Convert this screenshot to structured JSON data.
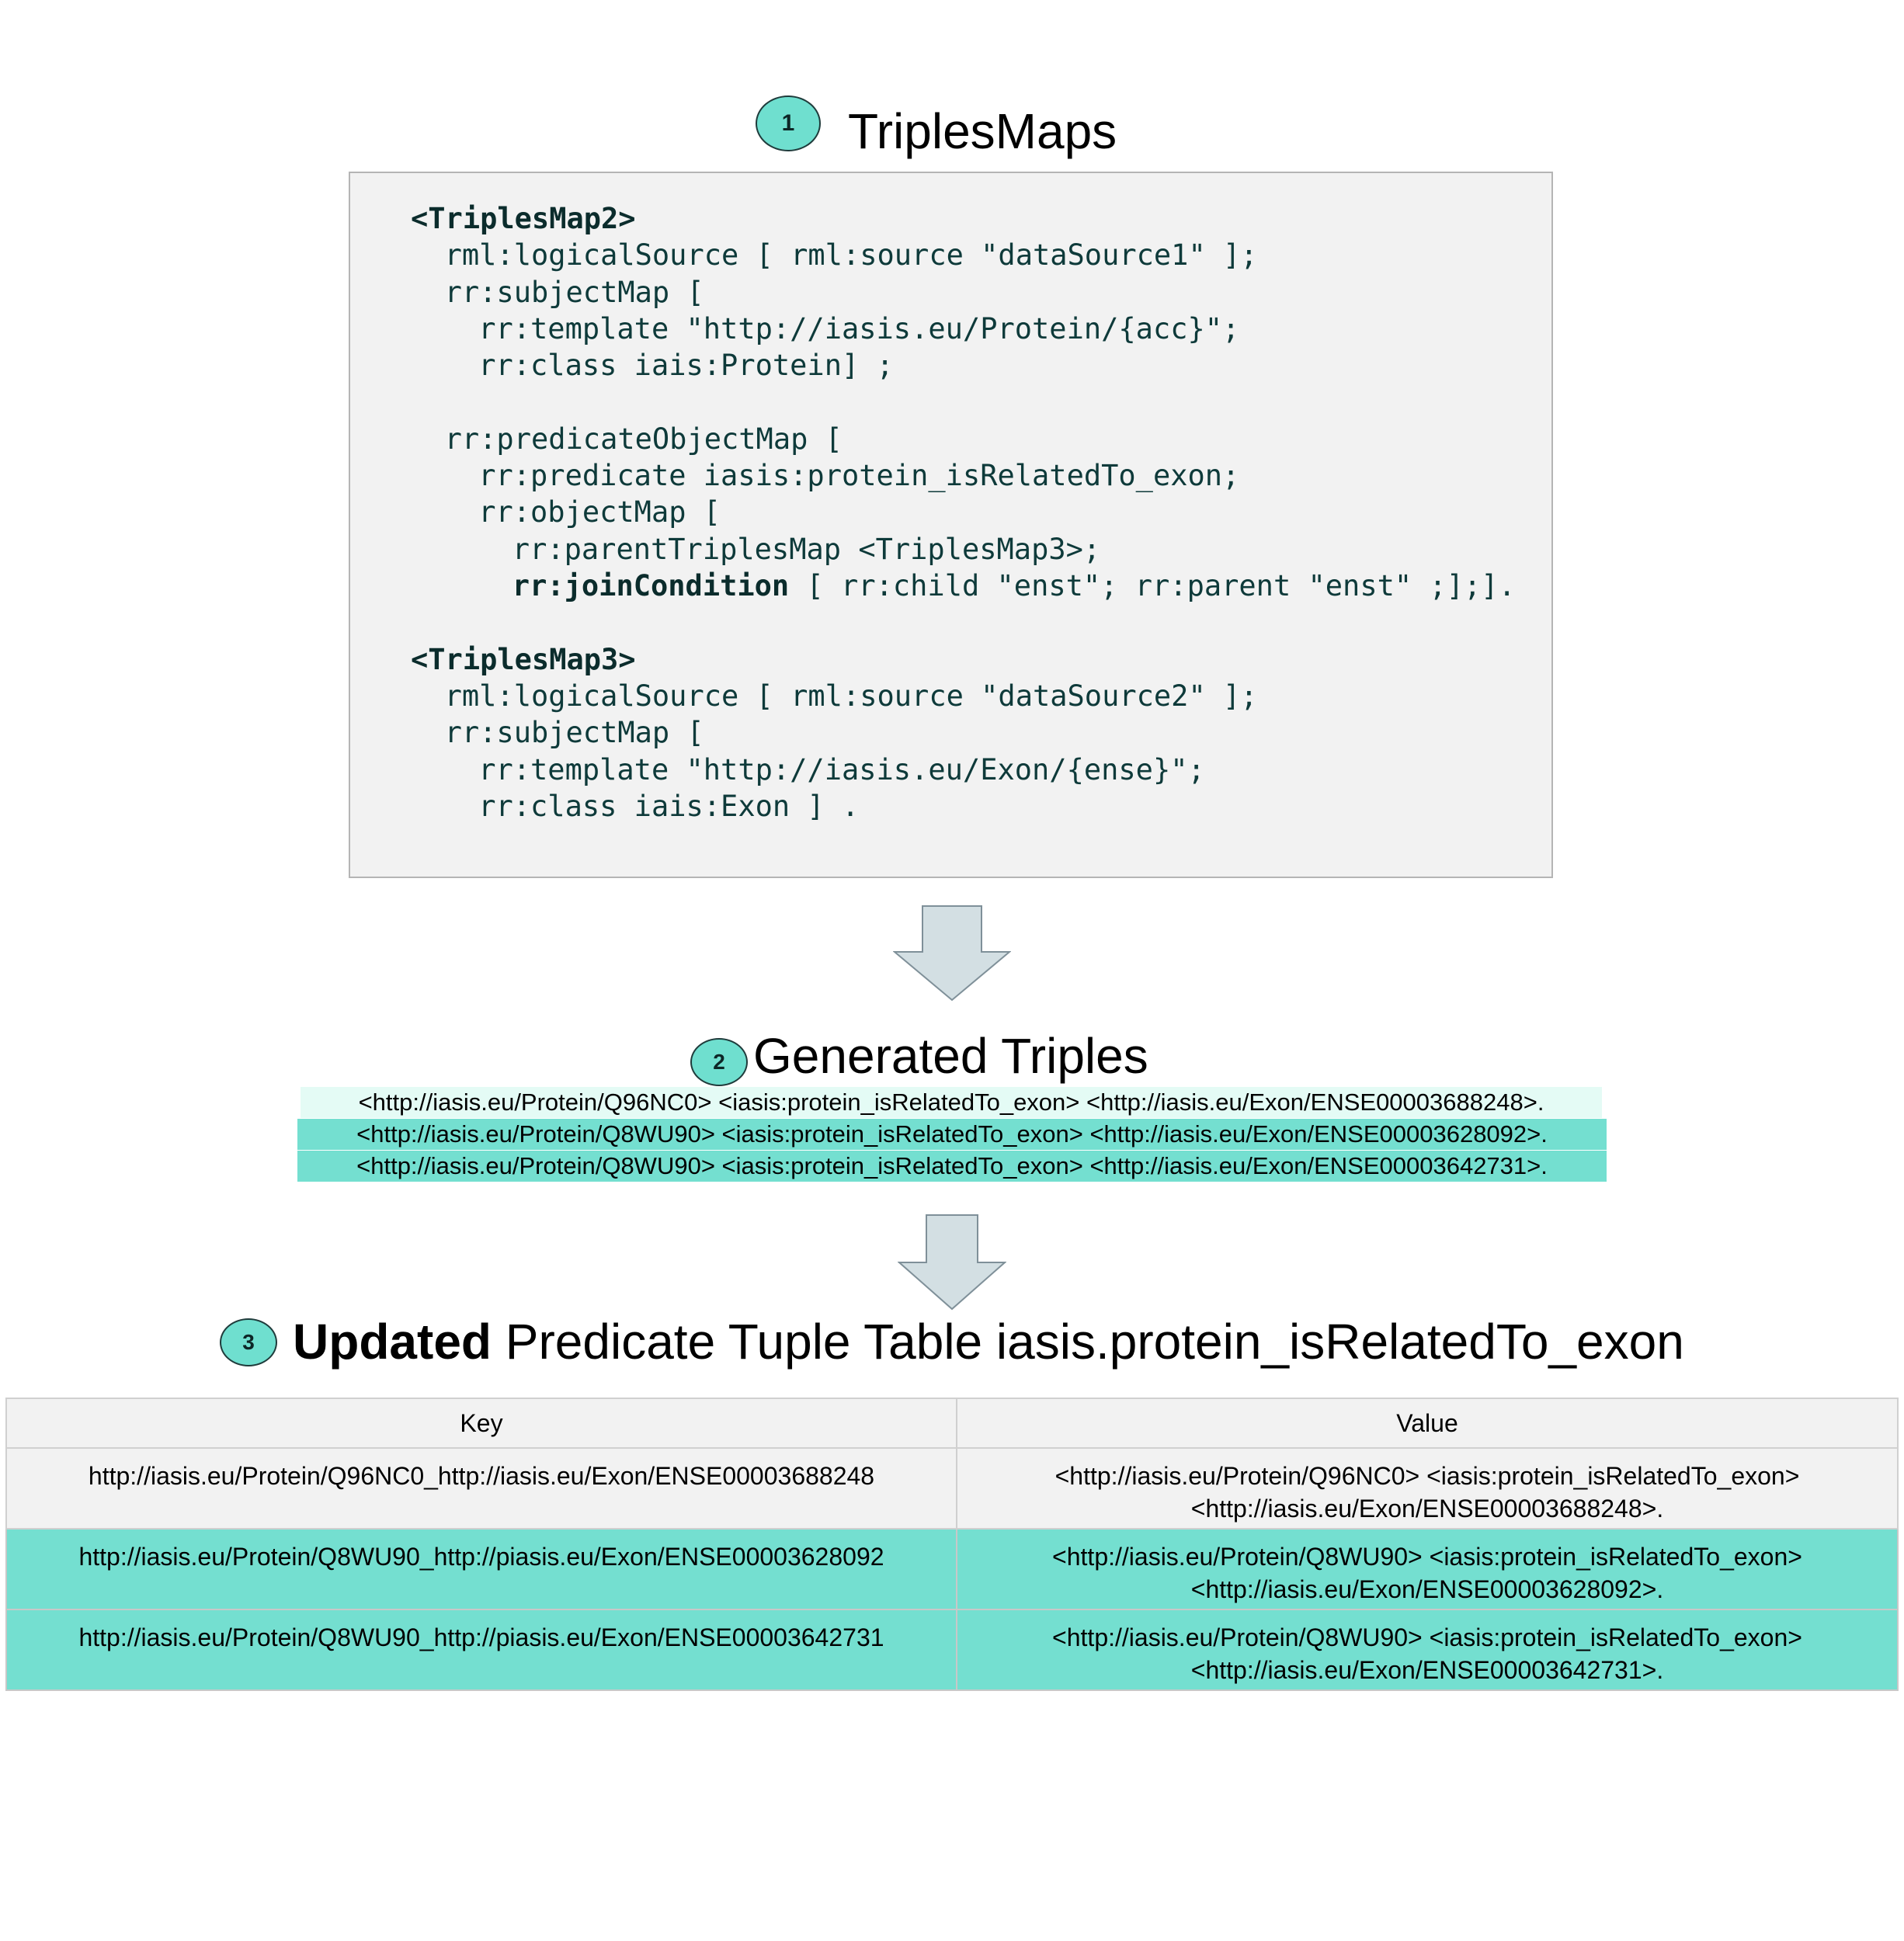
{
  "sections": {
    "s1": {
      "number": "1",
      "title": "TriplesMaps"
    },
    "s2": {
      "number": "2",
      "title": "Generated Triples"
    },
    "s3": {
      "number": "3",
      "title_bold": "Updated",
      "title_rest": " Predicate Tuple Table iasis.protein_isRelatedTo_exon"
    }
  },
  "code": {
    "lines": [
      {
        "indent": 0,
        "text": "<TriplesMap2>",
        "bold": true
      },
      {
        "indent": 2,
        "text": "rml:logicalSource [ rml:source \"dataSource1\" ];"
      },
      {
        "indent": 2,
        "text": "rr:subjectMap ["
      },
      {
        "indent": 4,
        "text": "rr:template \"http://iasis.eu/Protein/{acc}\";"
      },
      {
        "indent": 4,
        "text": "rr:class iais:Protein] ;"
      },
      {
        "indent": 0,
        "text": ""
      },
      {
        "indent": 2,
        "text": "rr:predicateObjectMap ["
      },
      {
        "indent": 4,
        "text": "rr:predicate iasis:protein_isRelatedTo_exon;"
      },
      {
        "indent": 4,
        "text": "rr:objectMap ["
      },
      {
        "indent": 6,
        "text": "rr:parentTriplesMap <TriplesMap3>;"
      },
      {
        "indent": 6,
        "kw": "rr:joinCondition",
        "text": " [ rr:child \"enst\"; rr:parent \"enst\" ;];]."
      },
      {
        "indent": 0,
        "text": ""
      },
      {
        "indent": 0,
        "text": "<TriplesMap3>",
        "bold": true
      },
      {
        "indent": 2,
        "text": "rml:logicalSource [ rml:source \"dataSource2\" ];"
      },
      {
        "indent": 2,
        "text": "rr:subjectMap ["
      },
      {
        "indent": 4,
        "text": "rr:template \"http://iasis.eu/Exon/{ense}\";"
      },
      {
        "indent": 4,
        "text": "rr:class iais:Exon ] ."
      }
    ]
  },
  "triples": [
    {
      "text": "<http://iasis.eu/Protein/Q96NC0> <iasis:protein_isRelatedTo_exon> <http://iasis.eu/Exon/ENSE00003688248>.",
      "highlight": "#e4fbf5"
    },
    {
      "text": "<http://iasis.eu/Protein/Q8WU90> <iasis:protein_isRelatedTo_exon> <http://iasis.eu/Exon/ENSE00003628092>.",
      "highlight": "#74dfd0"
    },
    {
      "text": "<http://iasis.eu/Protein/Q8WU90> <iasis:protein_isRelatedTo_exon> <http://iasis.eu/Exon/ENSE00003642731>.",
      "highlight": "#74dfd0"
    }
  ],
  "table": {
    "headers": {
      "key": "Key",
      "value": "Value"
    },
    "rows": [
      {
        "key": "http://iasis.eu/Protein/Q96NC0_http://iasis.eu/Exon/ENSE00003688248",
        "value_line1": "<http://iasis.eu/Protein/Q96NC0> <iasis:protein_isRelatedTo_exon>",
        "value_line2": "<http://iasis.eu/Exon/ENSE00003688248>.",
        "highlighted": false
      },
      {
        "key": "http://iasis.eu/Protein/Q8WU90_http://piasis.eu/Exon/ENSE00003628092",
        "value_line1": "<http://iasis.eu/Protein/Q8WU90> <iasis:protein_isRelatedTo_exon>",
        "value_line2": "<http://iasis.eu/Exon/ENSE00003628092>.",
        "highlighted": true
      },
      {
        "key": "http://iasis.eu/Protein/Q8WU90_http://piasis.eu/Exon/ENSE00003642731",
        "value_line1": "<http://iasis.eu/Protein/Q8WU90> <iasis:protein_isRelatedTo_exon>",
        "value_line2": "<http://iasis.eu/Exon/ENSE00003642731>.",
        "highlighted": true
      }
    ]
  },
  "colors": {
    "badge_fill": "#6fdfcf",
    "code_bg": "#f2f2f2",
    "code_text": "#0e3a3a",
    "arrow_fill": "#d3dfe3",
    "row_highlight": "#74dfd0",
    "triple_light": "#e4fbf5"
  }
}
